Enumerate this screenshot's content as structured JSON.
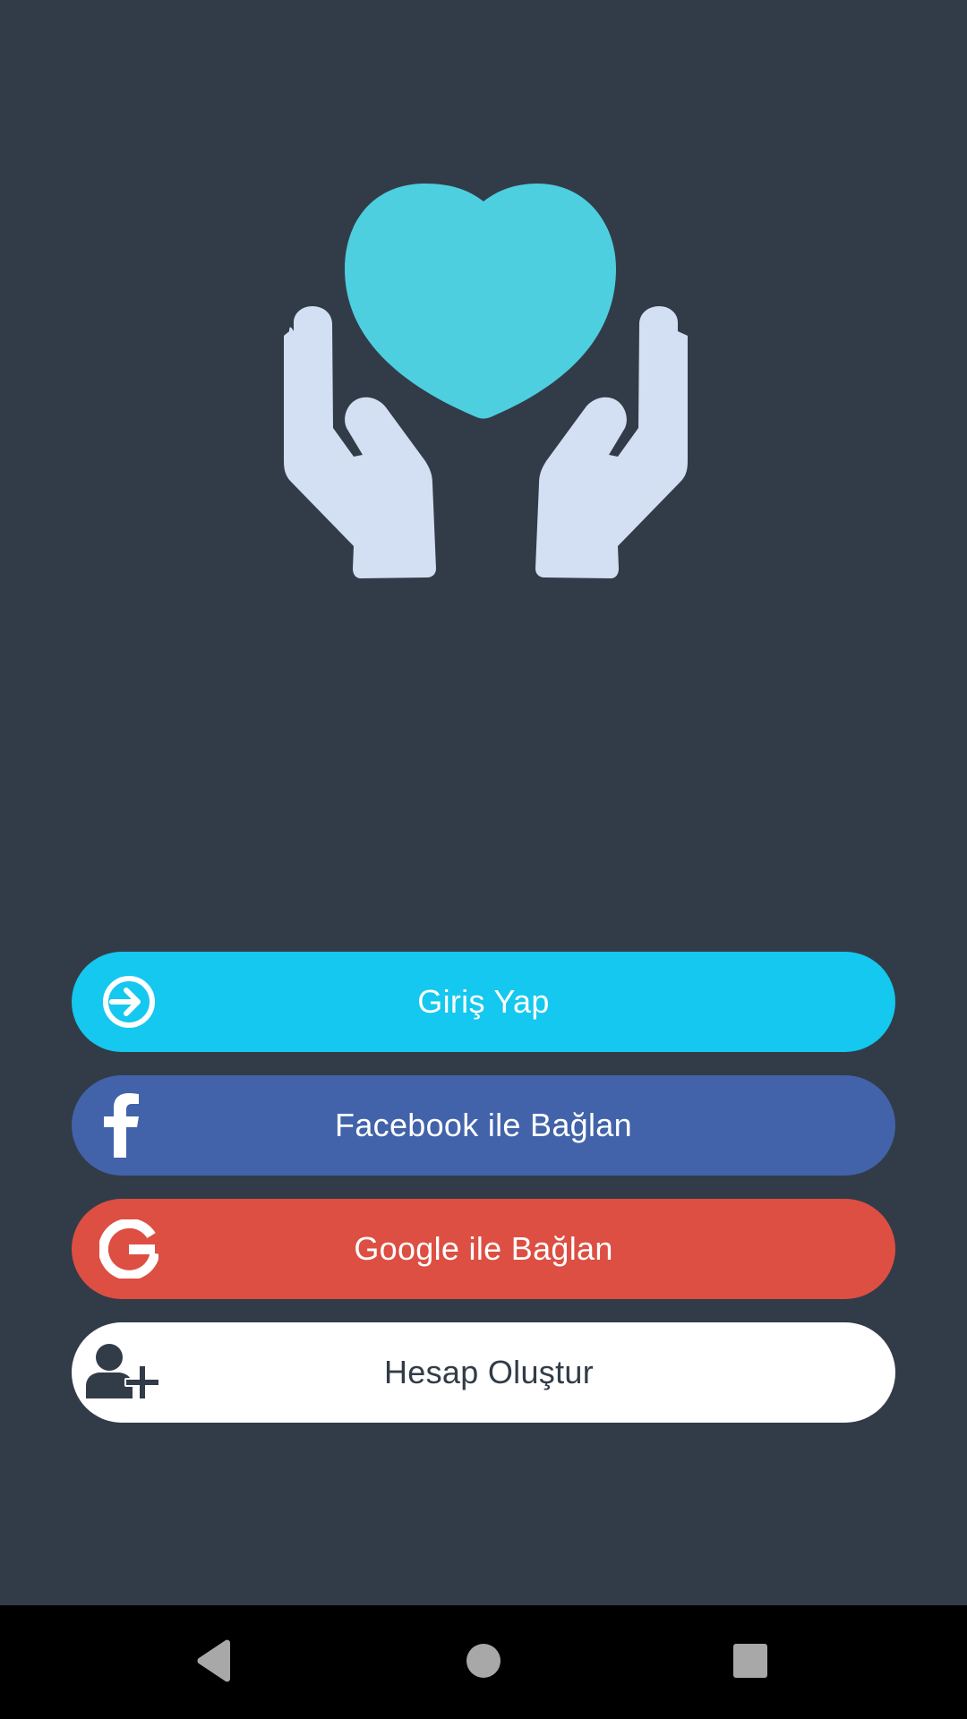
{
  "app": {
    "logo_icon": "hands-holding-heart-icon",
    "colors": {
      "background": "#323c48",
      "heart": "#4dcfe0",
      "hands": "#d3dff2"
    }
  },
  "buttons": {
    "login": {
      "label": "Giriş Yap",
      "icon": "sign-in-icon",
      "color": "#14c8ef"
    },
    "facebook": {
      "label": "Facebook ile Bağlan",
      "icon": "facebook-icon",
      "color": "#4263aa"
    },
    "google": {
      "label": "Google ile Bağlan",
      "icon": "google-icon",
      "color": "#dd4f43"
    },
    "create_account": {
      "label": "Hesap Oluştur",
      "icon": "user-plus-icon",
      "color": "#ffffff"
    }
  },
  "navbar": {
    "back_icon": "back-triangle-icon",
    "home_icon": "home-circle-icon",
    "recents_icon": "recents-square-icon"
  }
}
